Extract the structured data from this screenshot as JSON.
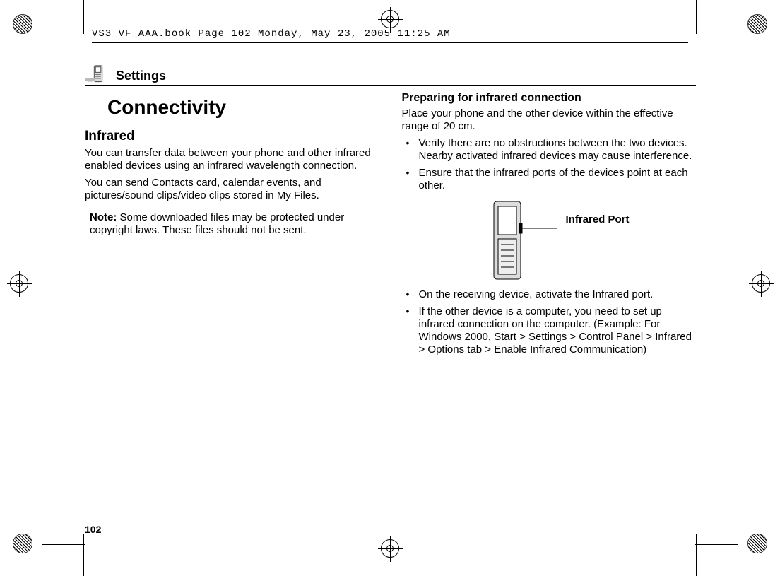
{
  "running_header": "VS3_VF_AAA.book  Page 102  Monday, May 23, 2005  11:25 AM",
  "section_title": "Settings",
  "page_title": "Connectivity",
  "left": {
    "heading": "Infrared",
    "p1": "You can transfer data between your phone and other infrared enabled devices using an infrared wavelength connection.",
    "p2": "You can send Contacts card, calendar events, and pictures/sound clips/video clips stored in My Files.",
    "note_label": "Note:",
    "note_body": " Some downloaded files may be protected under copyright laws. These files should not be sent."
  },
  "right": {
    "heading": "Preparing for infrared connection",
    "p1": "Place your phone and the other device within the effective range of 20 cm.",
    "b1": "Verify there are no obstructions between the two devices. Nearby activated infrared devices may cause interference.",
    "b2": "Ensure that the infrared ports of the devices point at each other.",
    "ir_label": "Infrared Port",
    "b3": "On the receiving device, activate the Infrared port.",
    "b4": "If the other device is a computer, you need to set up infrared connection on the computer. (Example: For Windows 2000, Start > Settings > Control Panel > Infrared > Options tab > Enable Infrared Communication)"
  },
  "page_number": "102"
}
